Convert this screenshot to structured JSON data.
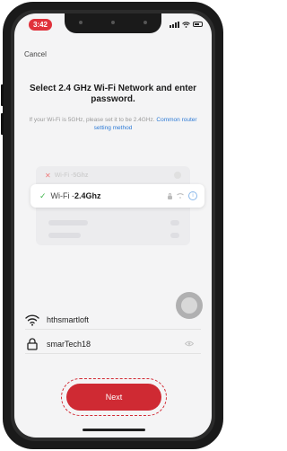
{
  "status_bar": {
    "time": "3:42"
  },
  "header": {
    "cancel_label": "Cancel"
  },
  "main": {
    "title": "Select 2.4 GHz Wi-Fi Network and enter password.",
    "hint_text": "If your Wi-Fi is 5GHz, please set it to be 2.4GHz.",
    "hint_link": "Common router setting method"
  },
  "illustration": {
    "unsupported_prefix": "Wi-Fi - ",
    "unsupported_band": "5Ghz",
    "supported_prefix": "Wi-Fi - ",
    "supported_band": "2.4Ghz"
  },
  "form": {
    "ssid_value": "hthsmartloft",
    "password_value": "smarTech18"
  },
  "actions": {
    "next_label": "Next"
  },
  "colors": {
    "accent": "#cf2a33",
    "link": "#2e7bd6",
    "success": "#3fb54a"
  }
}
